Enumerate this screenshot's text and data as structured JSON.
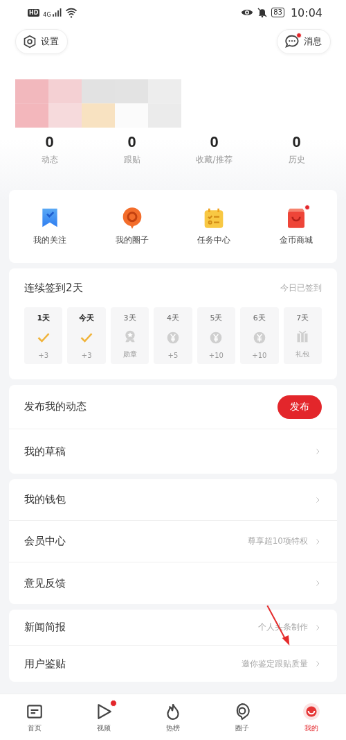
{
  "status_bar": {
    "hd": "HD",
    "network": "4G",
    "battery": "83",
    "time": "10:04"
  },
  "header": {
    "settings_button": "设置",
    "messages_button": {
      "label": "消息",
      "unread": true
    }
  },
  "profile": {
    "kind": "picture"
  },
  "stats": [
    {
      "value": "0",
      "label": "动态"
    },
    {
      "value": "0",
      "label": "跟贴"
    },
    {
      "value": "0",
      "label": "收藏/推荐"
    },
    {
      "value": "0",
      "label": "历史"
    }
  ],
  "shortcuts": [
    {
      "label": "我的关注",
      "badge": false
    },
    {
      "label": "我的圈子",
      "badge": false
    },
    {
      "label": "任务中心",
      "badge": false
    },
    {
      "label": "金币商城",
      "badge": true
    }
  ],
  "checkin": {
    "title": "连续签到2天",
    "status": "今日已签到",
    "days": [
      {
        "label": "1天",
        "kind": "check",
        "reward": "+3",
        "done": true
      },
      {
        "label": "今天",
        "kind": "check",
        "reward": "+3",
        "done": true
      },
      {
        "label": "3天",
        "kind": "medal",
        "reward": "勋章",
        "done": false
      },
      {
        "label": "4天",
        "kind": "coin",
        "reward": "+5",
        "done": false
      },
      {
        "label": "5天",
        "kind": "coin",
        "reward": "+10",
        "done": false
      },
      {
        "label": "6天",
        "kind": "coin",
        "reward": "+10",
        "done": false
      },
      {
        "label": "7天",
        "kind": "gift",
        "reward": "礼包",
        "done": false
      }
    ]
  },
  "menu_groups": [
    [
      {
        "label": "发布我的动态",
        "kind": "button",
        "button": "发布"
      },
      {
        "label": "我的草稿",
        "kind": "link"
      }
    ],
    [
      {
        "label": "我的钱包",
        "kind": "link"
      },
      {
        "label": "会员中心",
        "kind": "link",
        "hint": "尊享超10项特权"
      },
      {
        "label": "意见反馈",
        "kind": "link"
      }
    ],
    [
      {
        "label": "新闻简报",
        "kind": "link",
        "hint": "个人头条制作"
      },
      {
        "label": "用户鉴贴",
        "kind": "link",
        "hint": "邀你鉴定跟贴质量"
      }
    ]
  ],
  "tab_bar": [
    {
      "label": "首页",
      "selected": false,
      "dot": false
    },
    {
      "label": "视频",
      "selected": false,
      "dot": true
    },
    {
      "label": "热榜",
      "selected": false,
      "dot": false
    },
    {
      "label": "圈子",
      "selected": false,
      "dot": false
    },
    {
      "label": "我的",
      "selected": true,
      "dot": false
    }
  ]
}
